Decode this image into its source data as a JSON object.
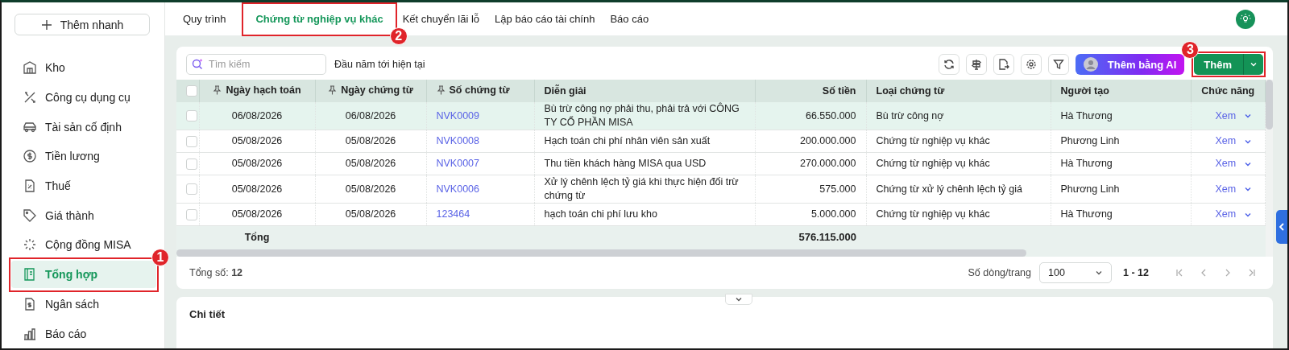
{
  "sidebar": {
    "quick_add": "Thêm nhanh",
    "items": [
      {
        "label": "Kho",
        "selected": false
      },
      {
        "label": "Công cụ dụng cụ",
        "selected": false
      },
      {
        "label": "Tài sản cố định",
        "selected": false
      },
      {
        "label": "Tiền lương",
        "selected": false
      },
      {
        "label": "Thuế",
        "selected": false
      },
      {
        "label": "Giá thành",
        "selected": false
      },
      {
        "label": "Cộng đồng MISA",
        "selected": false
      },
      {
        "label": "Tổng hợp",
        "selected": true,
        "callout": "1"
      },
      {
        "label": "Ngân sách",
        "selected": false
      },
      {
        "label": "Báo cáo",
        "selected": false
      }
    ]
  },
  "tabs": [
    {
      "label": "Quy trình",
      "selected": false
    },
    {
      "label": "Chứng từ nghiệp vụ khác",
      "selected": true,
      "callout": "2"
    },
    {
      "label": "Kết chuyển lãi lỗ",
      "selected": false
    },
    {
      "label": "Lập báo cáo tài chính",
      "selected": false
    },
    {
      "label": "Báo cáo",
      "selected": false
    }
  ],
  "toolbar": {
    "search_placeholder": "Tìm kiếm",
    "period": "Đầu năm tới hiện tại",
    "ai_button": "Thêm bằng AI",
    "add_button": {
      "label": "Thêm",
      "callout": "3"
    }
  },
  "table": {
    "all_checked": false,
    "columns": [
      {
        "label": "Ngày hạch toán",
        "pinned": true
      },
      {
        "label": "Ngày chứng từ",
        "pinned": true
      },
      {
        "label": "Số chứng từ",
        "pinned": true
      },
      {
        "label": "Diễn giải",
        "pinned": false
      },
      {
        "label": "Số tiền",
        "pinned": false
      },
      {
        "label": "Loại chứng từ",
        "pinned": false
      },
      {
        "label": "Người tạo",
        "pinned": false
      },
      {
        "label": "Chức năng",
        "pinned": false
      }
    ],
    "rows": [
      {
        "selected": true,
        "checked": false,
        "posting_date": "06/08/2026",
        "doc_date": "06/08/2026",
        "doc_no": "NVK0009",
        "description": "Bù trừ công nợ phải thu, phải trả với CÔNG TY CỔ PHẦN MISA",
        "amount": "66.550.000",
        "doc_type": "Bù trừ công nợ",
        "creator": "Hà Thương",
        "action": "Xem"
      },
      {
        "selected": false,
        "checked": false,
        "posting_date": "05/08/2026",
        "doc_date": "05/08/2026",
        "doc_no": "NVK0008",
        "description": "Hạch toán chi phí nhân viên sản xuất",
        "amount": "200.000.000",
        "doc_type": "Chứng từ nghiệp vụ khác",
        "creator": "Phương Linh",
        "action": "Xem"
      },
      {
        "selected": false,
        "checked": false,
        "posting_date": "05/08/2026",
        "doc_date": "05/08/2026",
        "doc_no": "NVK0007",
        "description": "Thu tiền khách hàng MISA qua USD",
        "amount": "270.000.000",
        "doc_type": "Chứng từ nghiệp vụ khác",
        "creator": "Hà Thương",
        "action": "Xem"
      },
      {
        "selected": false,
        "checked": false,
        "posting_date": "05/08/2026",
        "doc_date": "05/08/2026",
        "doc_no": "NVK0006",
        "description": " Xử lý chênh lệch tỷ giá khi thực hiện đối trừ chứng từ",
        "amount": "575.000",
        "doc_type": "Chứng từ xử lý chênh lệch tỷ giá",
        "creator": "Phương Linh",
        "action": "Xem"
      },
      {
        "selected": false,
        "checked": false,
        "posting_date": "05/08/2026",
        "doc_date": "05/08/2026",
        "doc_no": "123464",
        "description": "hạch toán chi phí lưu kho",
        "amount": "5.000.000",
        "doc_type": "Chứng từ nghiệp vụ khác",
        "creator": "Hà Thương",
        "action": "Xem"
      }
    ],
    "total_label": "Tổng",
    "total_amount": "576.115.000"
  },
  "footer": {
    "count": "Tổng số: **12**",
    "rows_per_page_label": "Số dòng/trang",
    "rows_per_page": "100",
    "range": "1 - 12"
  },
  "detail": {
    "title": "Chi tiết"
  }
}
